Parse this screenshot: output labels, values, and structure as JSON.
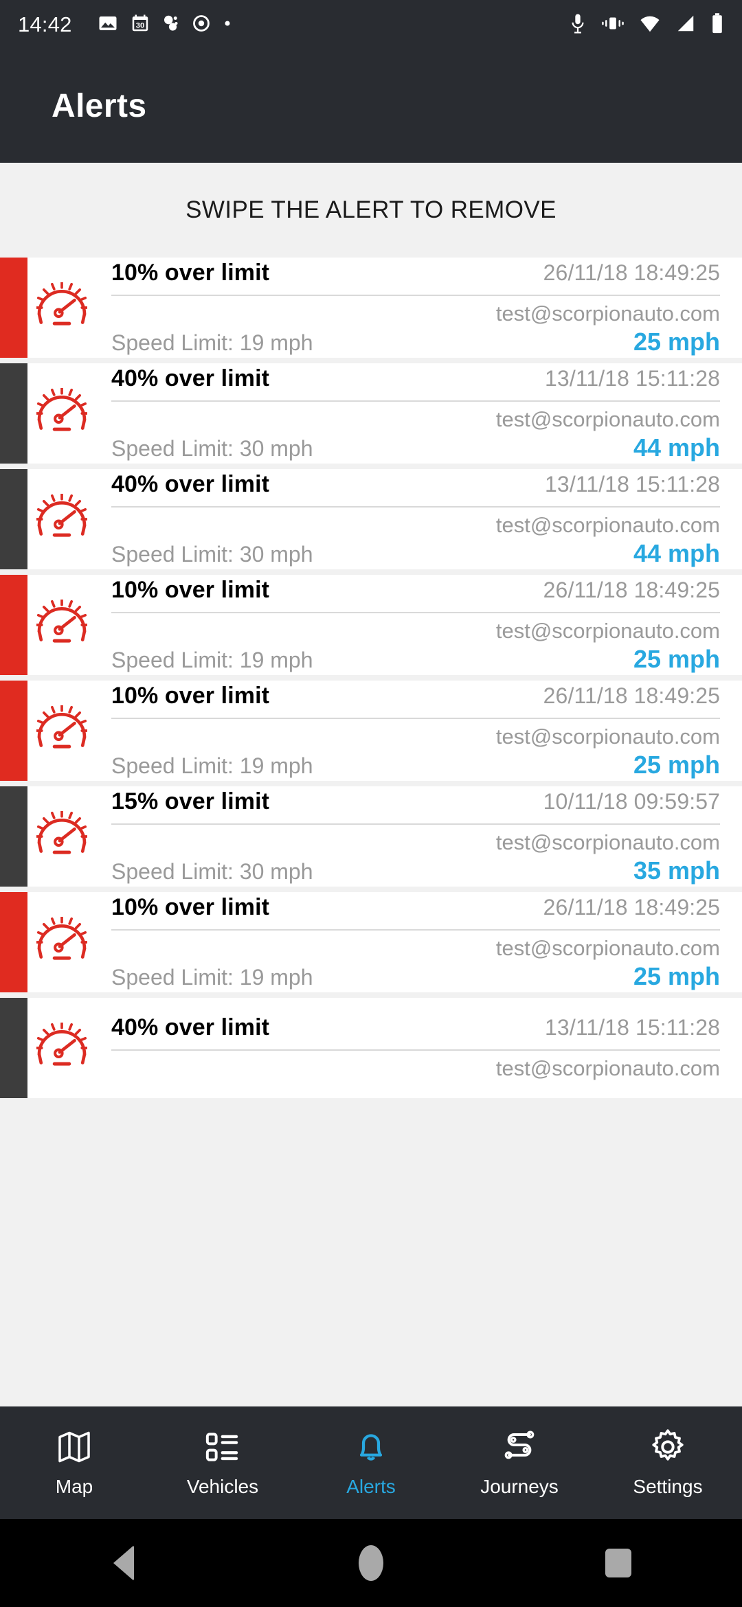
{
  "status_bar": {
    "time": "14:42",
    "left_icons": [
      "image-icon",
      "calendar-30-icon",
      "dots-icon",
      "record-circle-icon",
      "small-dot-icon"
    ],
    "right_icons": [
      "microphone-icon",
      "vibrate-icon",
      "wifi-icon",
      "signal-icon",
      "battery-icon"
    ]
  },
  "header": {
    "title": "Alerts"
  },
  "banner": {
    "text": "SWIPE THE ALERT TO REMOVE"
  },
  "colors": {
    "accent_blue": "#28a8e0",
    "alert_red": "#e02b20",
    "alert_dark": "#3d3d3d",
    "header_bg": "#292c31",
    "list_bg": "#f1f1f1"
  },
  "alerts": [
    {
      "stripe": "#e02b20",
      "icon": "speedometer-icon",
      "title": "10% over limit",
      "timestamp": "26/11/18 18:49:25",
      "email": "test@scorpionauto.com",
      "speed_limit": "Speed Limit: 19 mph",
      "speed": "25 mph"
    },
    {
      "stripe": "#3d3d3d",
      "icon": "speedometer-icon",
      "title": "40% over limit",
      "timestamp": "13/11/18 15:11:28",
      "email": "test@scorpionauto.com",
      "speed_limit": "Speed Limit: 30 mph",
      "speed": "44 mph"
    },
    {
      "stripe": "#3d3d3d",
      "icon": "speedometer-icon",
      "title": "40% over limit",
      "timestamp": "13/11/18 15:11:28",
      "email": "test@scorpionauto.com",
      "speed_limit": "Speed Limit: 30 mph",
      "speed": "44 mph"
    },
    {
      "stripe": "#e02b20",
      "icon": "speedometer-icon",
      "title": "10% over limit",
      "timestamp": "26/11/18 18:49:25",
      "email": "test@scorpionauto.com",
      "speed_limit": "Speed Limit: 19 mph",
      "speed": "25 mph"
    },
    {
      "stripe": "#e02b20",
      "icon": "speedometer-icon",
      "title": "10% over limit",
      "timestamp": "26/11/18 18:49:25",
      "email": "test@scorpionauto.com",
      "speed_limit": "Speed Limit: 19 mph",
      "speed": "25 mph"
    },
    {
      "stripe": "#3d3d3d",
      "icon": "speedometer-icon",
      "title": "15% over limit",
      "timestamp": "10/11/18 09:59:57",
      "email": "test@scorpionauto.com",
      "speed_limit": "Speed Limit: 30 mph",
      "speed": "35 mph"
    },
    {
      "stripe": "#e02b20",
      "icon": "speedometer-icon",
      "title": "10% over limit",
      "timestamp": "26/11/18 18:49:25",
      "email": "test@scorpionauto.com",
      "speed_limit": "Speed Limit: 19 mph",
      "speed": "25 mph"
    },
    {
      "stripe": "#3d3d3d",
      "icon": "speedometer-icon",
      "title": "40% over limit",
      "timestamp": "13/11/18 15:11:28",
      "email": "test@scorpionauto.com",
      "speed_limit": "",
      "speed": ""
    }
  ],
  "bottom_nav": {
    "active": "Alerts",
    "items": [
      {
        "label": "Map",
        "icon": "map-icon"
      },
      {
        "label": "Vehicles",
        "icon": "vehicle-list-icon"
      },
      {
        "label": "Alerts",
        "icon": "bell-icon"
      },
      {
        "label": "Journeys",
        "icon": "route-icon"
      },
      {
        "label": "Settings",
        "icon": "gear-icon"
      }
    ]
  },
  "android_nav": {
    "back": "back-button",
    "home": "home-button",
    "recents": "recents-button"
  }
}
